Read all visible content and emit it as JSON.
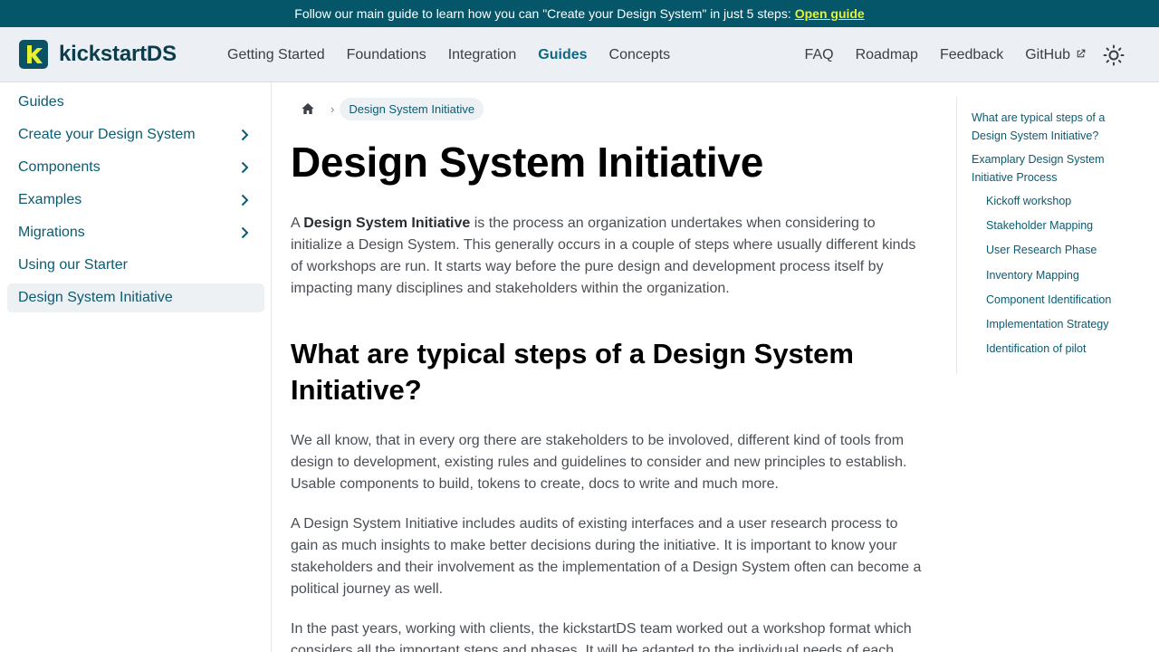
{
  "announcement": {
    "text": "Follow our main guide to learn how you can \"Create your Design System\" in just 5 steps:",
    "link": "Open guide"
  },
  "brand": {
    "name": "kickstartDS",
    "logo_letter": "k"
  },
  "navbar": {
    "left": [
      {
        "label": "Getting Started",
        "active": false
      },
      {
        "label": "Foundations",
        "active": false
      },
      {
        "label": "Integration",
        "active": false
      },
      {
        "label": "Guides",
        "active": true
      },
      {
        "label": "Concepts",
        "active": false
      }
    ],
    "right": [
      "FAQ",
      "Roadmap",
      "Feedback",
      "GitHub"
    ],
    "theme_icon": "sun-icon",
    "external_icon": "external-link-icon"
  },
  "sidebar": {
    "items": [
      {
        "label": "Guides",
        "expandable": false
      },
      {
        "label": "Create your Design System",
        "expandable": true
      },
      {
        "label": "Components",
        "expandable": true
      },
      {
        "label": "Examples",
        "expandable": true
      },
      {
        "label": "Migrations",
        "expandable": true
      },
      {
        "label": "Using our Starter",
        "expandable": false
      },
      {
        "label": "Design System Initiative",
        "expandable": false,
        "active": true
      }
    ]
  },
  "breadcrumb": {
    "home_icon": "home-icon",
    "current": "Design System Initiative"
  },
  "article": {
    "title": "Design System Initiative",
    "intro_bold": "Design System Initiative",
    "intro_prefix": "A ",
    "intro_rest": " is the process an organization undertakes when considering to initialize a Design System. This generally occurs in a couple of steps where usually different kinds of workshops are run. It starts way before the pure design and development process itself by impacting many disciplines and stakeholders within the organization.",
    "h2": "What are typical steps of a Design System Initiative?",
    "p1": "We all know, that in every org there are stakeholders to be involoved, different kind of tools from design to development, existing rules and guidelines to consider and new principles to establish. Usable components to build, tokens to create, docs to write and much more.",
    "p2": "A Design System Initiative includes audits of existing interfaces and a user research process to gain as much insights to make better decisions during the initiative. It is important to know your stakeholders and their involvement as the implementation of a Design System often can become a political journey as well.",
    "p3": "In the past years, working with clients, the kickstartDS team worked out a workshop format which considers all the important steps and phases. It will be adapted to the individual needs of each"
  },
  "toc": [
    {
      "label": "What are typical steps of a Design System Initiative?",
      "sub": false
    },
    {
      "label": "Examplary Design System Initiative Process",
      "sub": false
    },
    {
      "label": "Kickoff workshop",
      "sub": true
    },
    {
      "label": "Stakeholder Mapping",
      "sub": true
    },
    {
      "label": "User Research Phase",
      "sub": true
    },
    {
      "label": "Inventory Mapping",
      "sub": true
    },
    {
      "label": "Component Identification",
      "sub": true
    },
    {
      "label": "Implementation Strategy",
      "sub": true
    },
    {
      "label": "Identification of pilot",
      "sub": true
    }
  ]
}
